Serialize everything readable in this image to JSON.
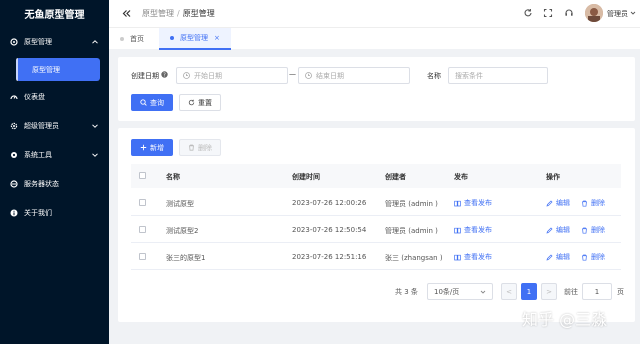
{
  "app": {
    "title": "无鱼原型管理"
  },
  "sidebar": {
    "items": [
      {
        "label": "原型管理",
        "icon": "gear-icon"
      },
      {
        "label": "原型管理",
        "icon": "none"
      },
      {
        "label": "仪表盘",
        "icon": "dashboard-icon"
      },
      {
        "label": "超级管理员",
        "icon": "settings-icon"
      },
      {
        "label": "系统工具",
        "icon": "gear-icon"
      },
      {
        "label": "服务器状态",
        "icon": "server-icon"
      },
      {
        "label": "关于我们",
        "icon": "info-icon"
      }
    ]
  },
  "header": {
    "breadcrumb": [
      "原型管理",
      "原型管理"
    ],
    "user": "管理员"
  },
  "tabs": [
    {
      "label": "首页"
    },
    {
      "label": "原型管理",
      "close": "×"
    }
  ],
  "search": {
    "date_label": "创建日期",
    "start_placeholder": "开始日期",
    "end_placeholder": "结束日期",
    "range_sep": "—",
    "name_label": "名称",
    "name_placeholder": "搜索条件",
    "query_label": "查询",
    "reset_label": "重置"
  },
  "toolbar": {
    "add_label": "新增",
    "delete_label": "删除"
  },
  "table": {
    "headers": [
      "名称",
      "创建时间",
      "创建者",
      "发布",
      "操作"
    ],
    "rows": [
      {
        "name": "测试原型",
        "created": "2023-07-26 12:00:26",
        "creator": "管理员 (admin )",
        "publish": "查看发布",
        "edit": "编辑",
        "delete": "删除"
      },
      {
        "name": "测试原型2",
        "created": "2023-07-26 12:50:54",
        "creator": "管理员 (admin )",
        "publish": "查看发布",
        "edit": "编辑",
        "delete": "删除"
      },
      {
        "name": "张三的原型1",
        "created": "2023-07-26 12:51:16",
        "creator": "张三 (zhangsan )",
        "publish": "查看发布",
        "edit": "编辑",
        "delete": "删除"
      }
    ]
  },
  "pagination": {
    "total": "共 3 条",
    "page_size": "10条/页",
    "prev": "<",
    "current": "1",
    "next": ">",
    "goto_label": "前往",
    "goto_value": "1",
    "page_suffix": "页"
  },
  "watermark": "知乎 @三淼",
  "colors": {
    "sidebar_bg": "#001529",
    "primary": "#4070f4"
  }
}
